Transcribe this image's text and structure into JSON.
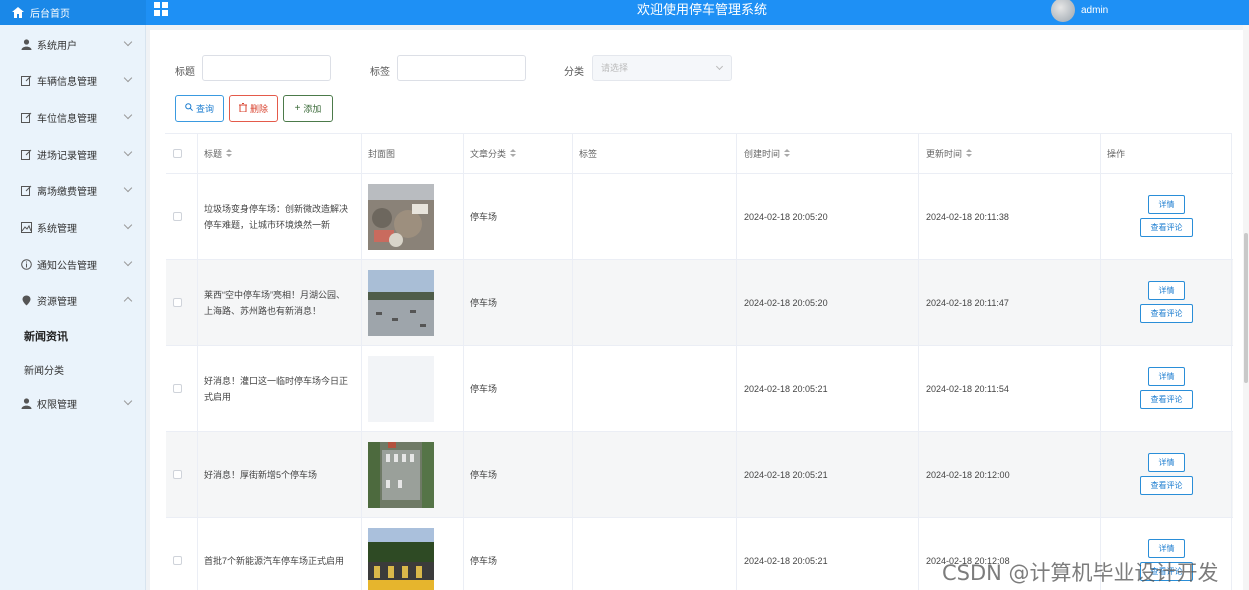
{
  "header": {
    "home_label": "后台首页",
    "app_title": "欢迎使用停车管理系统",
    "username": "admin"
  },
  "sidebar": {
    "items": [
      {
        "label": "系统用户",
        "icon": "user-icon"
      },
      {
        "label": "车辆信息管理",
        "icon": "edit-icon"
      },
      {
        "label": "车位信息管理",
        "icon": "edit-icon"
      },
      {
        "label": "进场记录管理",
        "icon": "edit-icon"
      },
      {
        "label": "离场缴费管理",
        "icon": "edit-icon"
      },
      {
        "label": "系统管理",
        "icon": "picture-icon"
      },
      {
        "label": "通知公告管理",
        "icon": "info-icon"
      },
      {
        "label": "资源管理",
        "icon": "location-icon"
      }
    ],
    "sub_items": [
      {
        "label": "新闻资讯"
      },
      {
        "label": "新闻分类"
      }
    ],
    "last_item": {
      "label": "权限管理",
      "icon": "user-icon"
    }
  },
  "filters": {
    "title_label": "标题",
    "tag_label": "标签",
    "category_label": "分类",
    "category_placeholder": "请选择"
  },
  "toolbar": {
    "query_label": "查询",
    "delete_label": "删除",
    "add_label": "添加"
  },
  "table": {
    "headers": {
      "title": "标题",
      "cover": "封面图",
      "category": "文章分类",
      "tags": "标签",
      "created": "创建时间",
      "updated": "更新时间",
      "actions": "操作"
    },
    "detail_label": "详情",
    "comments_label": "查看评论",
    "rows": [
      {
        "title": "垃圾场变身停车场：创新微改造解决停车难题，让城市环境焕然一新",
        "category": "停车场",
        "tags": "",
        "created": "2024-02-18 20:05:20",
        "updated": "2024-02-18 20:11:38"
      },
      {
        "title": "莱西“空中停车场”亮相！月湖公园、上海路、苏州路也有新消息！",
        "category": "停车场",
        "tags": "",
        "created": "2024-02-18 20:05:20",
        "updated": "2024-02-18 20:11:47"
      },
      {
        "title": "好消息！灌口这一临时停车场今日正式启用",
        "category": "停车场",
        "tags": "",
        "created": "2024-02-18 20:05:21",
        "updated": "2024-02-18 20:11:54"
      },
      {
        "title": "好消息！厚街新增5个停车场",
        "category": "停车场",
        "tags": "",
        "created": "2024-02-18 20:05:21",
        "updated": "2024-02-18 20:12:00"
      },
      {
        "title": "首批7个新能源汽车停车场正式启用",
        "category": "停车场",
        "tags": "",
        "created": "2024-02-18 20:05:21",
        "updated": "2024-02-18 20:12:08"
      }
    ]
  },
  "watermark": "CSDN @计算机毕业设计开发"
}
